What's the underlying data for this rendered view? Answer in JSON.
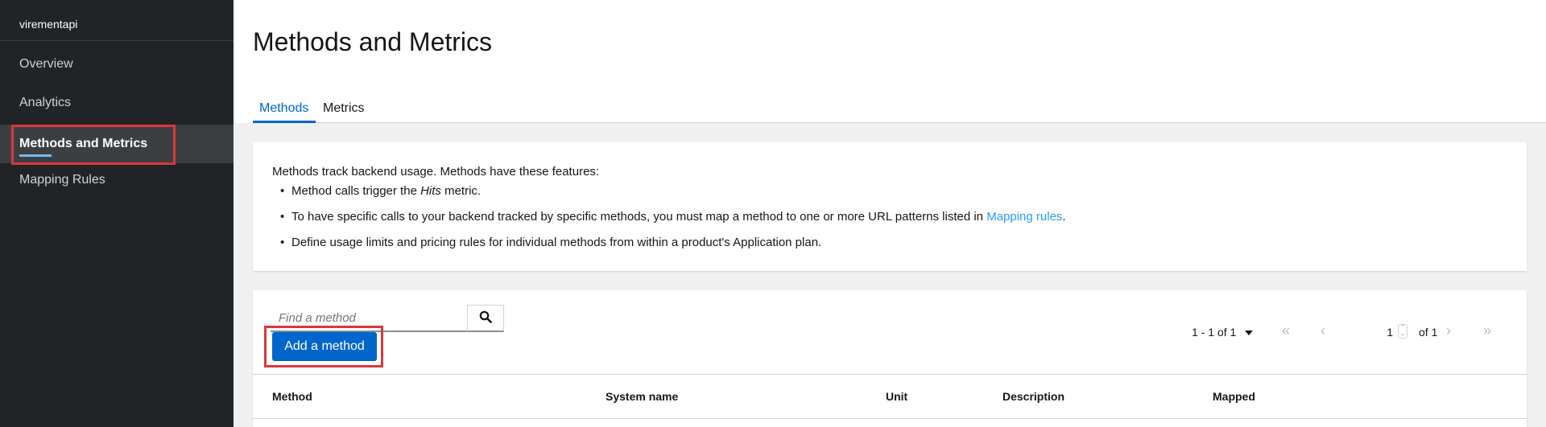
{
  "sidebar": {
    "title": "virementapi",
    "items": [
      {
        "label": "Overview"
      },
      {
        "label": "Analytics"
      },
      {
        "label": "Methods and Metrics"
      },
      {
        "label": "Mapping Rules"
      }
    ]
  },
  "page": {
    "title": "Methods and Metrics"
  },
  "tabs": [
    {
      "label": "Methods"
    },
    {
      "label": "Metrics"
    }
  ],
  "info": {
    "intro": "Methods track backend usage. Methods have these features:",
    "bullet1_pre": "Method calls trigger the ",
    "bullet1_em": "Hits",
    "bullet1_post": " metric.",
    "bullet2_pre": "To have specific calls to your backend tracked by specific methods, you must map a method to one or more URL patterns listed in ",
    "bullet2_link": "Mapping rules",
    "bullet2_post": ".",
    "bullet3": "Define usage limits and pricing rules for individual methods from within a product's Application plan."
  },
  "toolbar": {
    "search_placeholder": "Find a method",
    "add_label": "Add a method"
  },
  "pagination": {
    "range": "1 - 1 of 1",
    "page_value": "1",
    "of_total": "of 1"
  },
  "table": {
    "columns": [
      "Method",
      "System name",
      "Unit",
      "Description",
      "Mapped"
    ]
  },
  "colors": {
    "primary": "#0066cc",
    "link": "#2b9af3",
    "highlight": "#d9363e",
    "sidebar_bg": "#212427"
  },
  "icons": {
    "search": "search-icon",
    "first": "angle-double-left-icon",
    "prev": "angle-left-icon",
    "next": "angle-right-icon",
    "last": "angle-double-right-icon",
    "caret": "caret-down-icon"
  }
}
